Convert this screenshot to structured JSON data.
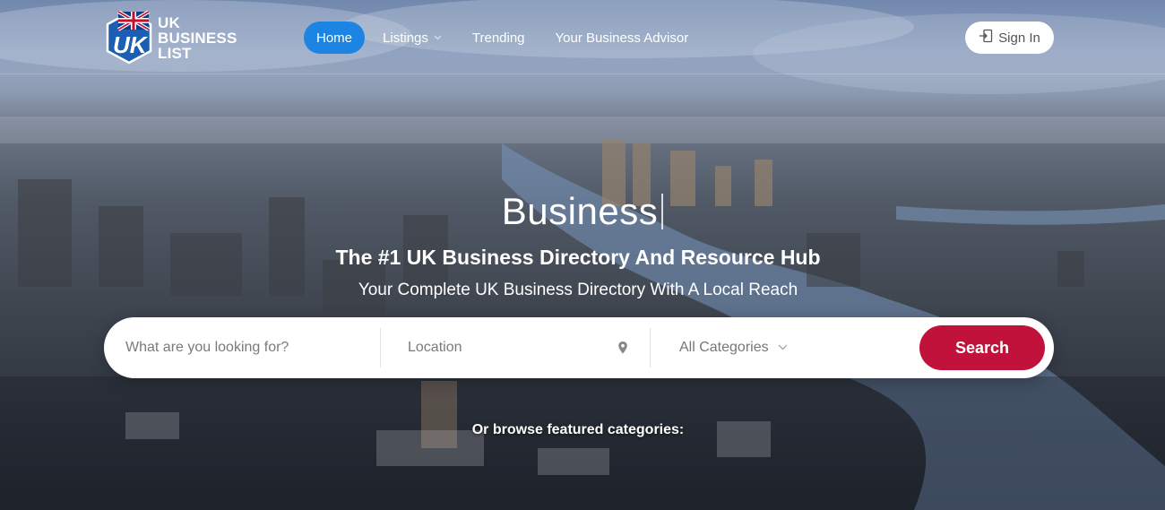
{
  "brand": {
    "line1": "UK",
    "line2": "BUSINESS LIST",
    "badge_text": "UK",
    "colors": {
      "badge_blue": "#1a5fb4",
      "union_red": "#c8102e"
    }
  },
  "nav": {
    "items": [
      {
        "label": "Home",
        "active": true
      },
      {
        "label": "Listings",
        "has_dropdown": true
      },
      {
        "label": "Trending"
      },
      {
        "label": "Your Business Advisor"
      }
    ],
    "signin_label": "Sign In"
  },
  "hero": {
    "title": "Business",
    "headline": "The #1 UK Business Directory And Resource Hub",
    "subheadline": "Your Complete UK Business Directory With A Local Reach"
  },
  "search": {
    "what_placeholder": "What are you looking for?",
    "location_placeholder": "Location",
    "category_value": "All Categories",
    "button_label": "Search"
  },
  "browse_label": "Or browse featured categories:",
  "colors": {
    "accent_blue": "#1c84e3",
    "search_red": "#c0123a"
  }
}
